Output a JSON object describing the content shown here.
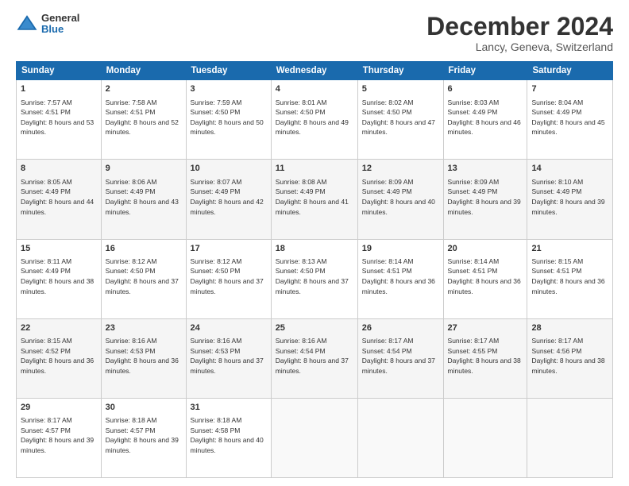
{
  "header": {
    "logo_general": "General",
    "logo_blue": "Blue",
    "month": "December 2024",
    "location": "Lancy, Geneva, Switzerland"
  },
  "days_of_week": [
    "Sunday",
    "Monday",
    "Tuesday",
    "Wednesday",
    "Thursday",
    "Friday",
    "Saturday"
  ],
  "weeks": [
    [
      {
        "day": 1,
        "rise": "7:57 AM",
        "set": "4:51 PM",
        "hours": "8 hours and 53 minutes."
      },
      {
        "day": 2,
        "rise": "7:58 AM",
        "set": "4:51 PM",
        "hours": "8 hours and 52 minutes."
      },
      {
        "day": 3,
        "rise": "7:59 AM",
        "set": "4:50 PM",
        "hours": "8 hours and 50 minutes."
      },
      {
        "day": 4,
        "rise": "8:01 AM",
        "set": "4:50 PM",
        "hours": "8 hours and 49 minutes."
      },
      {
        "day": 5,
        "rise": "8:02 AM",
        "set": "4:50 PM",
        "hours": "8 hours and 47 minutes."
      },
      {
        "day": 6,
        "rise": "8:03 AM",
        "set": "4:49 PM",
        "hours": "8 hours and 46 minutes."
      },
      {
        "day": 7,
        "rise": "8:04 AM",
        "set": "4:49 PM",
        "hours": "8 hours and 45 minutes."
      }
    ],
    [
      {
        "day": 8,
        "rise": "8:05 AM",
        "set": "4:49 PM",
        "hours": "8 hours and 44 minutes."
      },
      {
        "day": 9,
        "rise": "8:06 AM",
        "set": "4:49 PM",
        "hours": "8 hours and 43 minutes."
      },
      {
        "day": 10,
        "rise": "8:07 AM",
        "set": "4:49 PM",
        "hours": "8 hours and 42 minutes."
      },
      {
        "day": 11,
        "rise": "8:08 AM",
        "set": "4:49 PM",
        "hours": "8 hours and 41 minutes."
      },
      {
        "day": 12,
        "rise": "8:09 AM",
        "set": "4:49 PM",
        "hours": "8 hours and 40 minutes."
      },
      {
        "day": 13,
        "rise": "8:09 AM",
        "set": "4:49 PM",
        "hours": "8 hours and 39 minutes."
      },
      {
        "day": 14,
        "rise": "8:10 AM",
        "set": "4:49 PM",
        "hours": "8 hours and 39 minutes."
      }
    ],
    [
      {
        "day": 15,
        "rise": "8:11 AM",
        "set": "4:49 PM",
        "hours": "8 hours and 38 minutes."
      },
      {
        "day": 16,
        "rise": "8:12 AM",
        "set": "4:50 PM",
        "hours": "8 hours and 37 minutes."
      },
      {
        "day": 17,
        "rise": "8:12 AM",
        "set": "4:50 PM",
        "hours": "8 hours and 37 minutes."
      },
      {
        "day": 18,
        "rise": "8:13 AM",
        "set": "4:50 PM",
        "hours": "8 hours and 37 minutes."
      },
      {
        "day": 19,
        "rise": "8:14 AM",
        "set": "4:51 PM",
        "hours": "8 hours and 36 minutes."
      },
      {
        "day": 20,
        "rise": "8:14 AM",
        "set": "4:51 PM",
        "hours": "8 hours and 36 minutes."
      },
      {
        "day": 21,
        "rise": "8:15 AM",
        "set": "4:51 PM",
        "hours": "8 hours and 36 minutes."
      }
    ],
    [
      {
        "day": 22,
        "rise": "8:15 AM",
        "set": "4:52 PM",
        "hours": "8 hours and 36 minutes."
      },
      {
        "day": 23,
        "rise": "8:16 AM",
        "set": "4:53 PM",
        "hours": "8 hours and 36 minutes."
      },
      {
        "day": 24,
        "rise": "8:16 AM",
        "set": "4:53 PM",
        "hours": "8 hours and 37 minutes."
      },
      {
        "day": 25,
        "rise": "8:16 AM",
        "set": "4:54 PM",
        "hours": "8 hours and 37 minutes."
      },
      {
        "day": 26,
        "rise": "8:17 AM",
        "set": "4:54 PM",
        "hours": "8 hours and 37 minutes."
      },
      {
        "day": 27,
        "rise": "8:17 AM",
        "set": "4:55 PM",
        "hours": "8 hours and 38 minutes."
      },
      {
        "day": 28,
        "rise": "8:17 AM",
        "set": "4:56 PM",
        "hours": "8 hours and 38 minutes."
      }
    ],
    [
      {
        "day": 29,
        "rise": "8:17 AM",
        "set": "4:57 PM",
        "hours": "8 hours and 39 minutes."
      },
      {
        "day": 30,
        "rise": "8:18 AM",
        "set": "4:57 PM",
        "hours": "8 hours and 39 minutes."
      },
      {
        "day": 31,
        "rise": "8:18 AM",
        "set": "4:58 PM",
        "hours": "8 hours and 40 minutes."
      },
      null,
      null,
      null,
      null
    ]
  ]
}
